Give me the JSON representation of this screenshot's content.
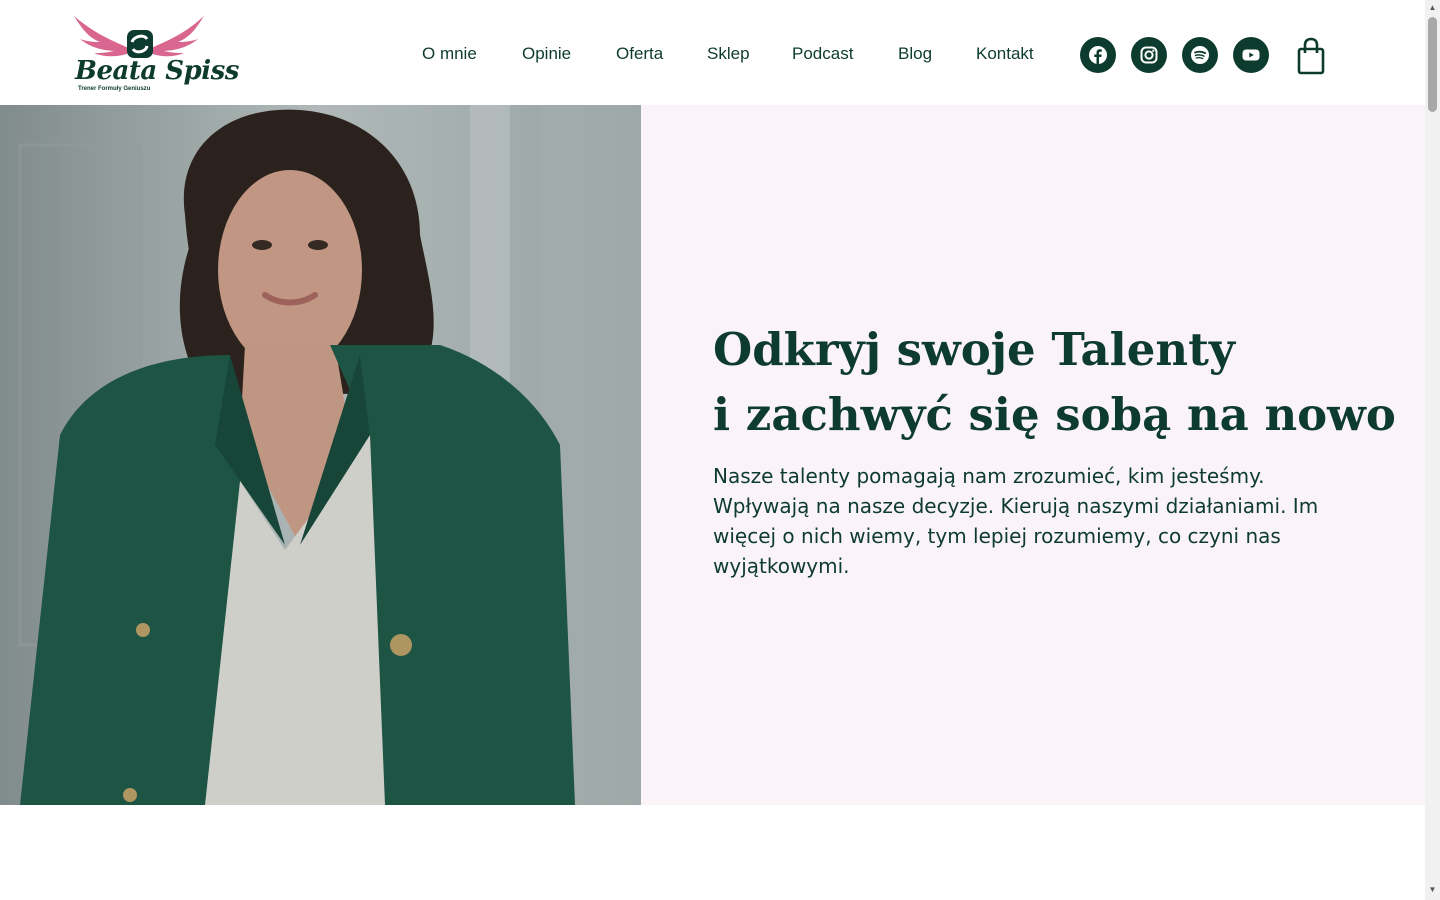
{
  "brand": {
    "name": "Beata Spiss",
    "tagline": "Trener Formuły Geniuszu",
    "logo_colors": {
      "wings": "#d9668e",
      "text": "#0d3b2e"
    }
  },
  "nav": {
    "items": [
      {
        "label": "O mnie"
      },
      {
        "label": "Opinie"
      },
      {
        "label": "Oferta"
      },
      {
        "label": "Sklep"
      },
      {
        "label": "Podcast"
      },
      {
        "label": "Blog"
      },
      {
        "label": "Kontakt"
      }
    ]
  },
  "social": [
    {
      "icon": "facebook-icon"
    },
    {
      "icon": "instagram-icon"
    },
    {
      "icon": "spotify-icon"
    },
    {
      "icon": "youtube-icon"
    }
  ],
  "cart": {
    "icon": "shopping-bag-icon"
  },
  "hero": {
    "title_line1": "Odkryj swoje Talenty",
    "title_line2": "i zachwyć się sobą na nowo",
    "description": "Nasze talenty pomagają nam zrozumieć, kim jesteśmy. Wpływają na nasze decyzje. Kierują naszymi działaniami. Im więcej o nich wiemy, tym lepiej rozumiemy, co czyni nas wyjątkowymi.",
    "photo": "portrait-photo"
  },
  "colors": {
    "primary": "#0d3b2e",
    "panel_bg": "#faf3f8",
    "accent_pink": "#d9668e"
  }
}
